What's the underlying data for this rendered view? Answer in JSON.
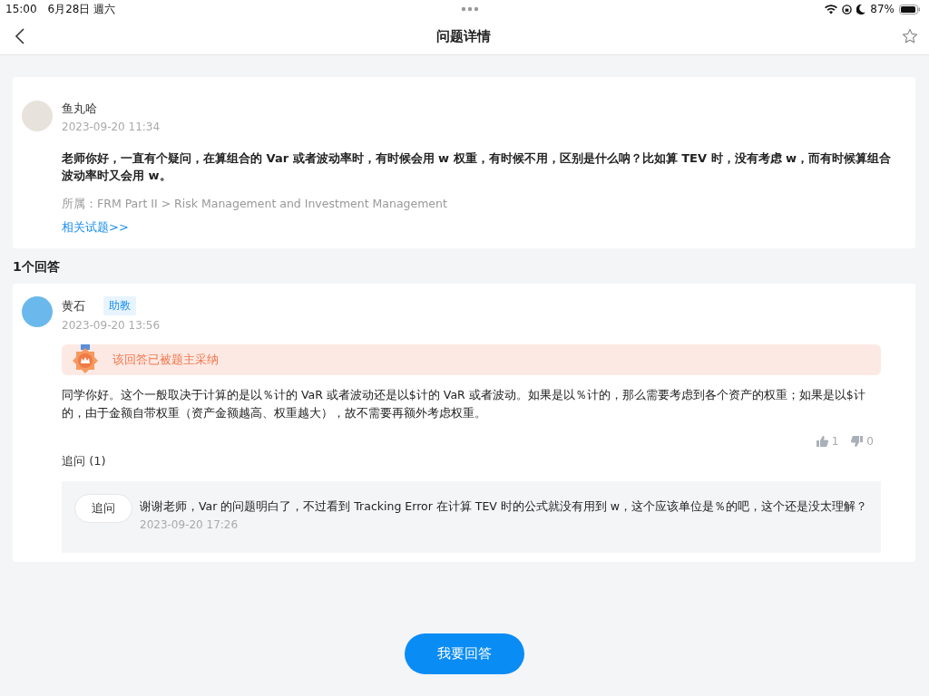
{
  "status_bar": {
    "time": "15:00",
    "date": "6月28日 週六",
    "battery": "87%"
  },
  "nav": {
    "title": "问题详情",
    "starred": false
  },
  "question": {
    "author": "鱼丸哈",
    "time": "2023-09-20 11:34",
    "text": "老师你好，一直有个疑问，在算组合的 Var 或者波动率时，有时候会用 w 权重，有时候不用，区别是什么呐？比如算 TEV 时，没有考虑 w，而有时候算组合波动率时又会用 w。",
    "category": "所属：FRM Part II > Risk Management and Investment Management",
    "related_link": "相关试题>>"
  },
  "answer_count": "1个回答",
  "answers": [
    {
      "author": "黄石",
      "role": "助教",
      "time": "2023-09-20 13:56",
      "adopted": true,
      "adopted_text": "该回答已被题主采纳",
      "text": "同学你好。这个一般取决于计算的是以％计的 VaR 或者波动还是以$计的 VaR 或者波动。如果是以％计的，那么需要考虑到各个资产的权重；如果是以$计的，由于金额自带权重（资产金额越高、权重越大），故不需要再额外考虑权重。",
      "likes": "1",
      "dislikes": "0",
      "followup_title": "追问 (1)",
      "followups": [
        {
          "tag": "追问",
          "text": "谢谢老师，Var 的问题明白了，不过看到 Tracking Error 在计算 TEV 时的公式就没有用到 w，这个应该单位是％的吧，这个还是没太理解？",
          "time": "2023-09-20 17:26"
        }
      ]
    }
  ],
  "footer": {
    "button": "我要回答"
  }
}
